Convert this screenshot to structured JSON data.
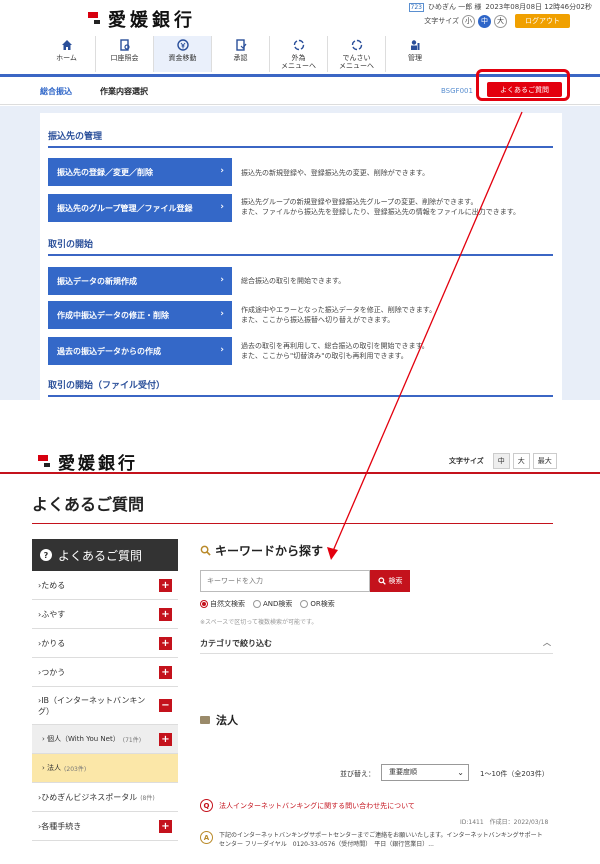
{
  "top": {
    "logo_text": "愛媛銀行",
    "user": {
      "tag": "723",
      "name": "ひめぎん 一郎 様",
      "datetime": "2023年08月08日 12時46分02秒"
    },
    "font_size": {
      "label": "文字サイズ",
      "small": "小",
      "medium": "中",
      "large": "大"
    },
    "logout": "ログアウト",
    "nav": [
      {
        "label": "ホーム",
        "icon": "home-icon"
      },
      {
        "label": "口座照会",
        "icon": "account-inquiry-icon"
      },
      {
        "label": "資金移動",
        "icon": "fund-transfer-icon"
      },
      {
        "label": "承認",
        "icon": "approval-icon"
      },
      {
        "label": "外為\nメニューへ",
        "icon": "forex-icon"
      },
      {
        "label": "でんさい\nメニューへ",
        "icon": "densai-icon"
      },
      {
        "label": "管理",
        "icon": "admin-icon"
      }
    ],
    "breadcrumb": {
      "category": "総合振込",
      "page": "作業内容選択"
    },
    "screen_code": "BSGF001",
    "faq_button": "よくあるご質問",
    "sections": {
      "s1": "振込先の管理",
      "s2": "取引の開始",
      "s3": "取引の開始（ファイル受付）"
    },
    "menu": [
      {
        "label": "振込先の登録／変更／削除",
        "desc": "振込先の新規登録や、登録振込先の変更、削除ができます。"
      },
      {
        "label": "振込先のグループ管理／ファイル登録",
        "desc": "振込先グループの新規登録や登録振込先グループの変更、削除ができます。\nまた、ファイルから振込先を登録したり、登録振込先の情報をファイルに出力できます。"
      },
      {
        "label": "振込データの新規作成",
        "desc": "総合振込の取引を開始できます。"
      },
      {
        "label": "作成中振込データの修正・削除",
        "desc": "作成途中やエラーとなった振込データを修正、削除できます。\nまた、ここから振込振替へ切り替えができます。"
      },
      {
        "label": "過去の振込データからの作成",
        "desc": "過去の取引を再利用して、総合振込の取引を開始できます。\nまた、ここから\"切替済み\"の取引も再利用できます。"
      }
    ]
  },
  "bottom": {
    "logo_text": "愛媛銀行",
    "font_size": {
      "label": "文字サイズ",
      "medium": "中",
      "large": "大",
      "max": "最大"
    },
    "page_title": "よくあるご質問",
    "sidebar": {
      "title": "よくあるご質問",
      "items": [
        {
          "label": "›ためる",
          "sign": "+"
        },
        {
          "label": "›ふやす",
          "sign": "+"
        },
        {
          "label": "›かりる",
          "sign": "+"
        },
        {
          "label": "›つかう",
          "sign": "+"
        },
        {
          "label": "›IB（インターネットバンキング）",
          "sign": "−"
        },
        {
          "label": "› 個人（With You Net）",
          "count": "(71件)",
          "sign": "+"
        },
        {
          "label": "› 法人",
          "count": "(203件)"
        },
        {
          "label": "›ひめぎんビジネスポータル",
          "count": "(8件)"
        },
        {
          "label": "›各種手続き",
          "sign": "+"
        }
      ]
    },
    "search": {
      "title": "キーワードから探す",
      "placeholder": "キーワードを入力",
      "button": "検索",
      "modes": [
        "自然文検索",
        "AND検索",
        "OR検索"
      ],
      "note": "※スペースで区切って複数検索が可能です。",
      "category": "カテゴリで絞り込む"
    },
    "section_title": "法人",
    "sort": {
      "label": "並び替え：",
      "value": "重要度順",
      "count": "1〜10件（全203件）"
    },
    "qa": {
      "question": "法人インターネットバンキングに関する問い合わせ先について",
      "meta": "ID:1411　作成日：2022/03/18",
      "answer": "下記のインターネットバンキングサポートセンターまでご連絡をお願いいたします。インターネットバンキングサポートセンター フリーダイヤル　0120-33-0576（受付時間）　平日（銀行営業日）..."
    }
  },
  "colors": {
    "brand_red": "#c4121c",
    "top_blue": "#3468c8",
    "highlight_red": "#e3000e"
  }
}
